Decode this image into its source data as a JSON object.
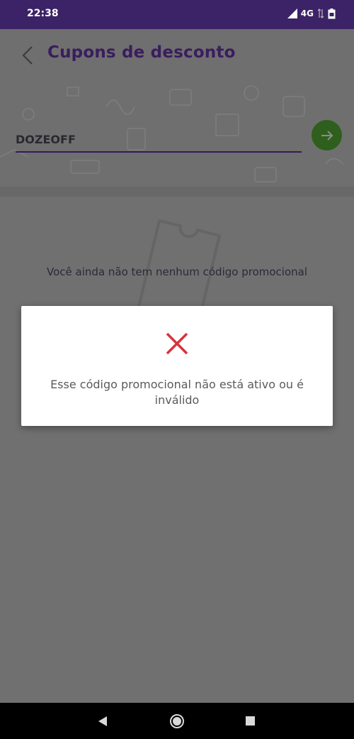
{
  "status_bar": {
    "time": "22:38",
    "network": "4G",
    "icons": [
      "signal-icon",
      "data-transfer-icon",
      "battery-icon"
    ]
  },
  "header": {
    "title": "Cupons de desconto",
    "back_icon": "chevron-left-icon"
  },
  "coupon": {
    "value": "DOZEOFF",
    "submit_icon": "arrow-right-icon"
  },
  "empty_state": {
    "message": "Você ainda não tem nenhum código promocional",
    "illustration": "ticket-icon"
  },
  "dialog": {
    "icon": "close-x-icon",
    "message": "Esse código promocional não está ativo ou é inválido"
  },
  "nav_bar": {
    "buttons": [
      "back-triangle-icon",
      "home-circle-icon",
      "recents-square-icon"
    ]
  },
  "colors": {
    "status_bar": "#3c2266",
    "title": "#3a1d5e",
    "accent_green": "#2f5f1c",
    "error_red": "#d8323c",
    "scrim": "#707070"
  }
}
